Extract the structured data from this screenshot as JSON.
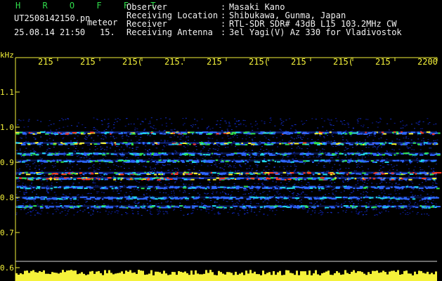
{
  "header": {
    "title": "H R O F F T",
    "filename": "UT2508142150.pn",
    "tag": "meteor",
    "datetime": "25.08.14 21:50",
    "duration": "15.",
    "info": [
      {
        "label": "Observer",
        "sep": ":",
        "value": "Masaki Kano"
      },
      {
        "label": "Receiving Location",
        "sep": ":",
        "value": "Shibukawa, Gunma, Japan"
      },
      {
        "label": "Receiver",
        "sep": ":",
        "value": "RTL-SDR SDR# 43dB L15 103.2MHz CW"
      },
      {
        "label": "Receiving Antenna",
        "sep": ":",
        "value": "3el Yagi(V) Az 330 for Vladivostok"
      }
    ]
  },
  "colors": {
    "background": "#000000",
    "header_green": "#2fdc4a",
    "header_white": "#f2f2f2",
    "axis_yellow": "#f5f23a",
    "signal_floor": "#0a1a9a"
  },
  "chart_data": {
    "type": "heatmap",
    "ylabel": "kHz",
    "y_ticks": [
      "1.1",
      "1.0",
      "0.9",
      "0.8",
      "0.7",
      "0.6"
    ],
    "x_ticks": [
      "215",
      "215",
      "215(",
      "215.",
      "215",
      "215(",
      "215",
      "215(",
      "215",
      "2200"
    ],
    "ylim": [
      0.6,
      1.15
    ],
    "bands": [
      {
        "freq": 0.985,
        "intensity": 0.85
      },
      {
        "freq": 0.955,
        "intensity": 0.75
      },
      {
        "freq": 0.925,
        "intensity": 0.6
      },
      {
        "freq": 0.905,
        "intensity": 0.55
      },
      {
        "freq": 0.87,
        "intensity": 0.95
      },
      {
        "freq": 0.855,
        "intensity": 0.9
      },
      {
        "freq": 0.83,
        "intensity": 0.5
      },
      {
        "freq": 0.8,
        "intensity": 0.45
      },
      {
        "freq": 0.775,
        "intensity": 0.55
      }
    ],
    "grid": false
  }
}
